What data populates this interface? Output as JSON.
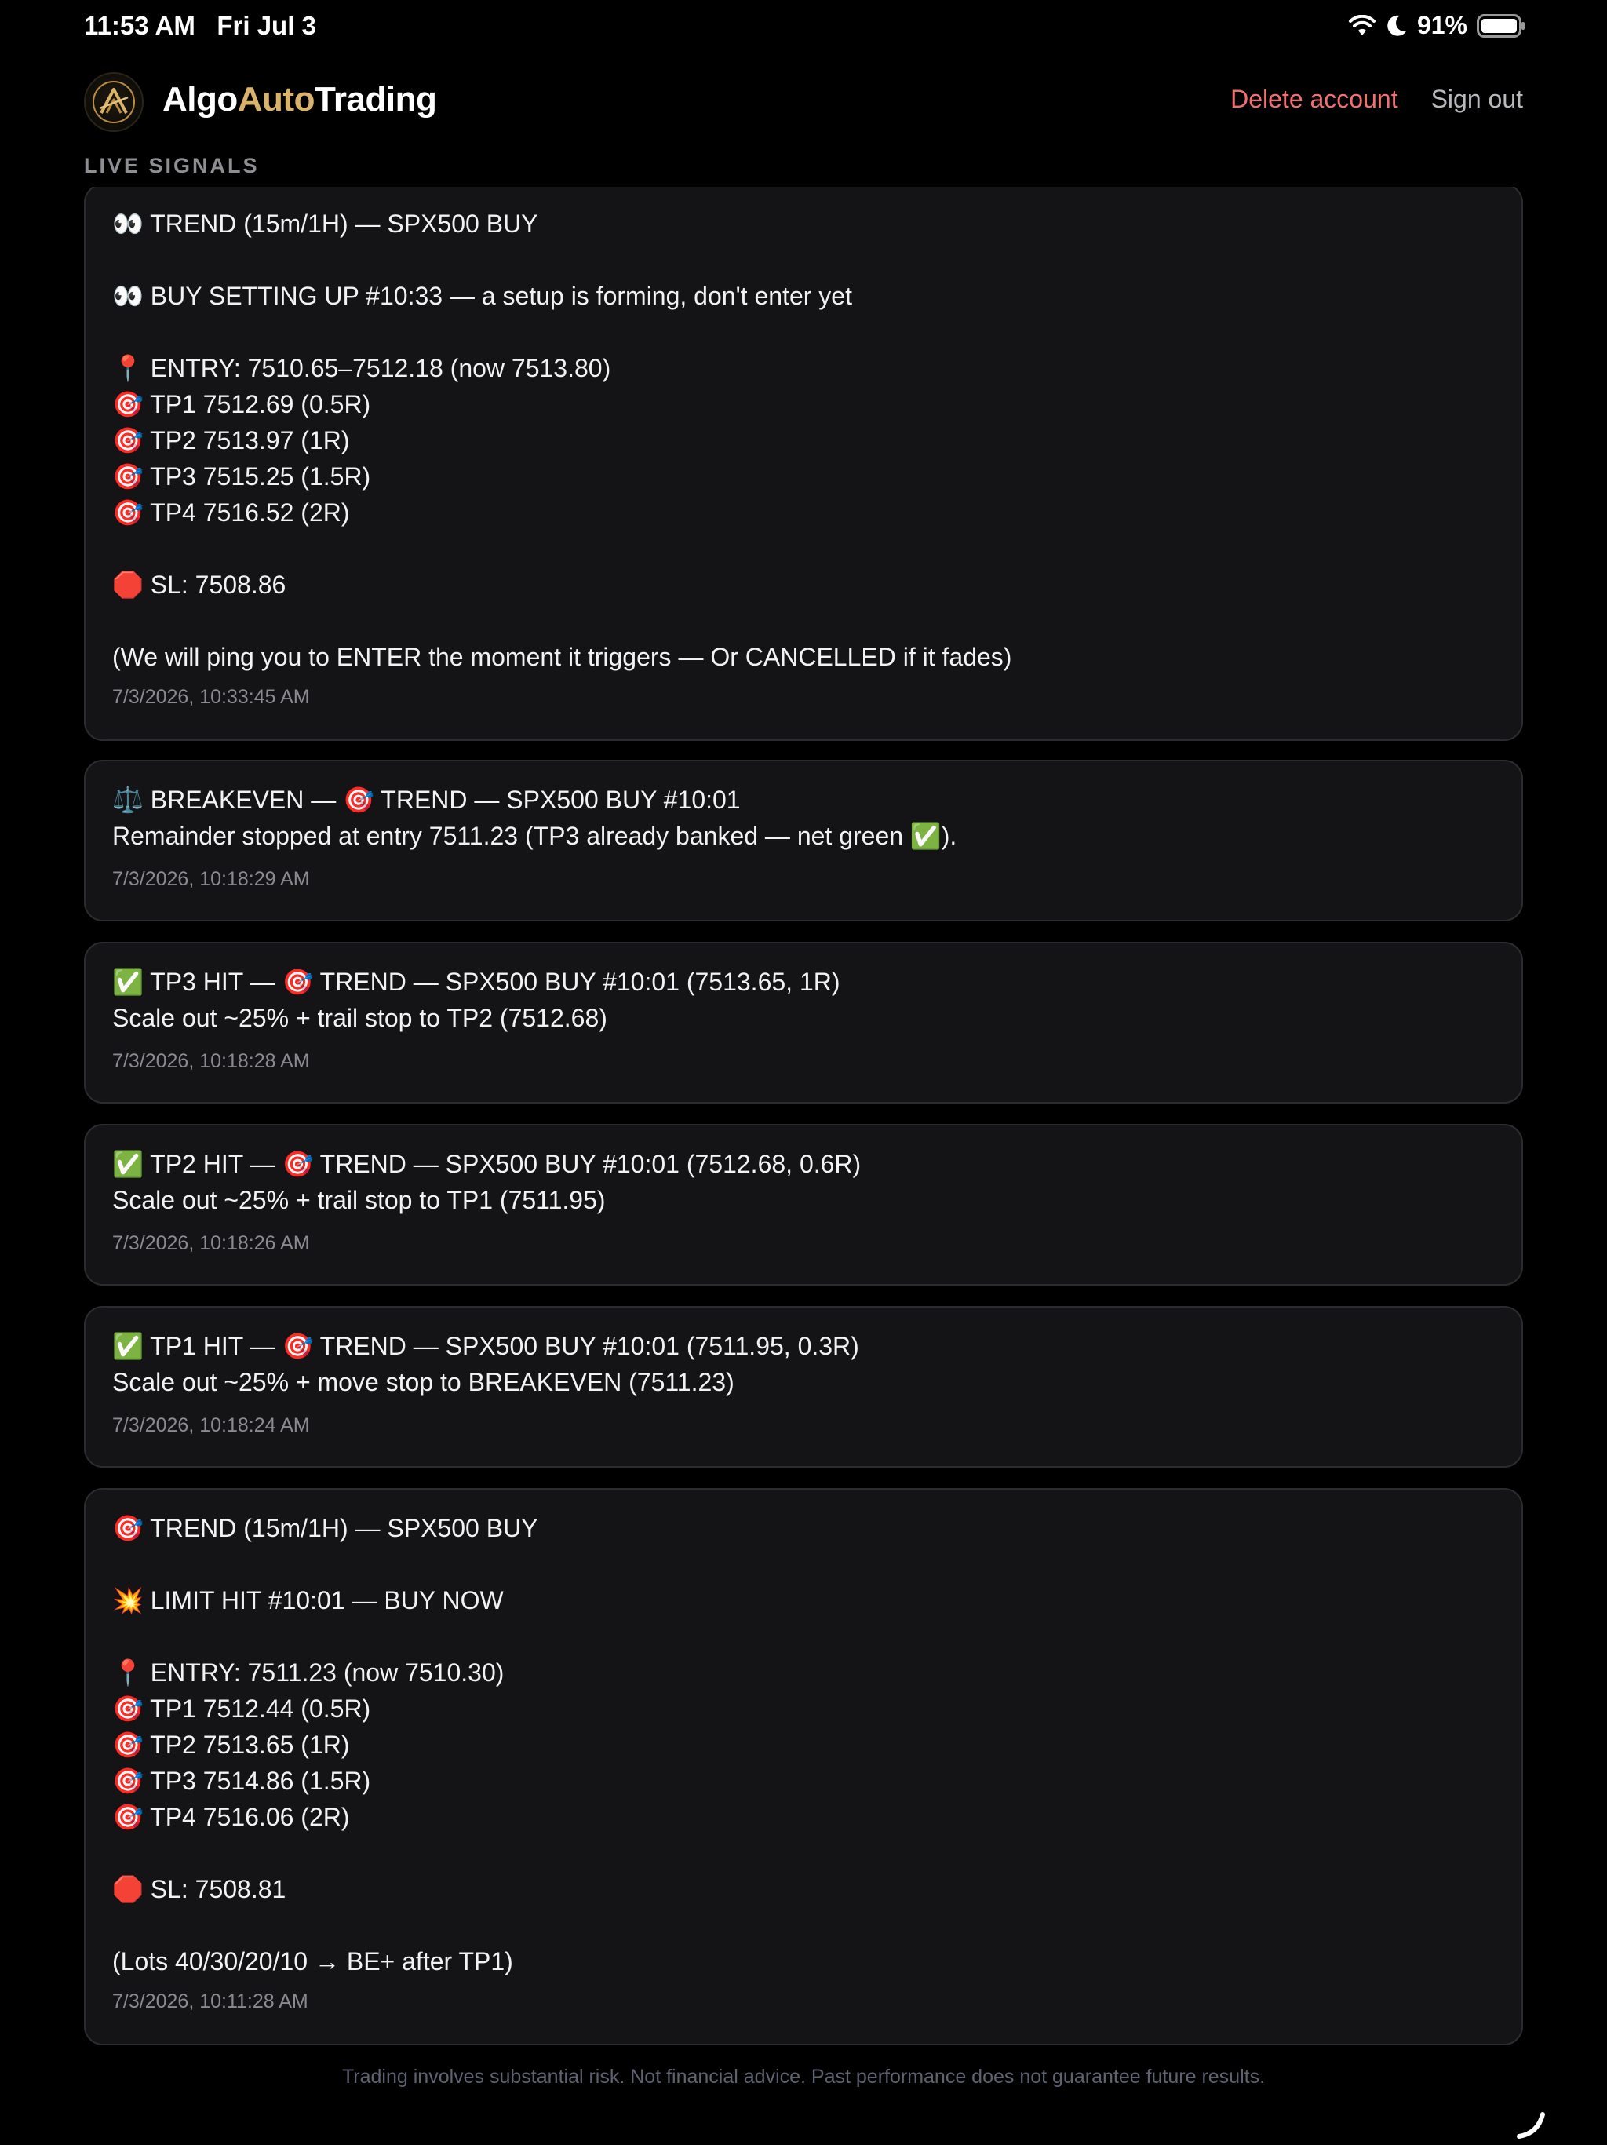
{
  "status_bar": {
    "time": "11:53 AM   Fri Jul 3",
    "battery": "91%",
    "icons": [
      "wifi-icon",
      "moon-icon",
      "battery-icon"
    ]
  },
  "header": {
    "brand_part1": "Algo",
    "brand_part2": "Auto",
    "brand_part3": "Trading",
    "delete_account": "Delete account",
    "sign_out": "Sign out",
    "accent_color": "#d9b36a",
    "danger_color": "#f07070"
  },
  "section_label": "LIVE SIGNALS",
  "signals": [
    {
      "text": "👀 TREND (15m/1H) — SPX500 BUY\n\n👀 BUY SETTING UP #10:33 — a setup is forming, don't enter yet\n\n📍 ENTRY: 7510.65–7512.18 (now 7513.80)\n🎯 TP1 7512.69 (0.5R)\n🎯 TP2 7513.97 (1R)\n🎯 TP3 7515.25 (1.5R)\n🎯 TP4 7516.52 (2R)\n\n🛑 SL: 7508.86\n\n(We will ping you to ENTER the moment it triggers — Or CANCELLED if it fades)",
      "timestamp": "7/3/2026, 10:33:45 AM"
    },
    {
      "text": "⚖️ BREAKEVEN — 🎯 TREND — SPX500 BUY #10:01\nRemainder stopped at entry 7511.23 (TP3 already banked — net green ✅).",
      "timestamp": "7/3/2026, 10:18:29 AM"
    },
    {
      "text": "✅ TP3 HIT — 🎯 TREND — SPX500 BUY #10:01 (7513.65, 1R)\nScale out ~25% + trail stop to TP2 (7512.68)",
      "timestamp": "7/3/2026, 10:18:28 AM"
    },
    {
      "text": "✅ TP2 HIT — 🎯 TREND — SPX500 BUY #10:01 (7512.68, 0.6R)\nScale out ~25% + trail stop to TP1 (7511.95)",
      "timestamp": "7/3/2026, 10:18:26 AM"
    },
    {
      "text": "✅ TP1 HIT — 🎯 TREND — SPX500 BUY #10:01 (7511.95, 0.3R)\nScale out ~25% + move stop to BREAKEVEN (7511.23)",
      "timestamp": "7/3/2026, 10:18:24 AM"
    },
    {
      "text": "🎯 TREND (15m/1H) — SPX500 BUY\n\n💥 LIMIT HIT #10:01 — BUY NOW\n\n📍 ENTRY: 7511.23 (now 7510.30)\n🎯 TP1 7512.44 (0.5R)\n🎯 TP2 7513.65 (1R)\n🎯 TP3 7514.86 (1.5R)\n🎯 TP4 7516.06 (2R)\n\n🛑 SL: 7508.81\n\n(Lots 40/30/20/10 → BE+ after TP1)",
      "timestamp": "7/3/2026, 10:11:28 AM"
    }
  ],
  "disclaimer": "Trading involves substantial risk. Not financial advice. Past performance does not guarantee future results."
}
